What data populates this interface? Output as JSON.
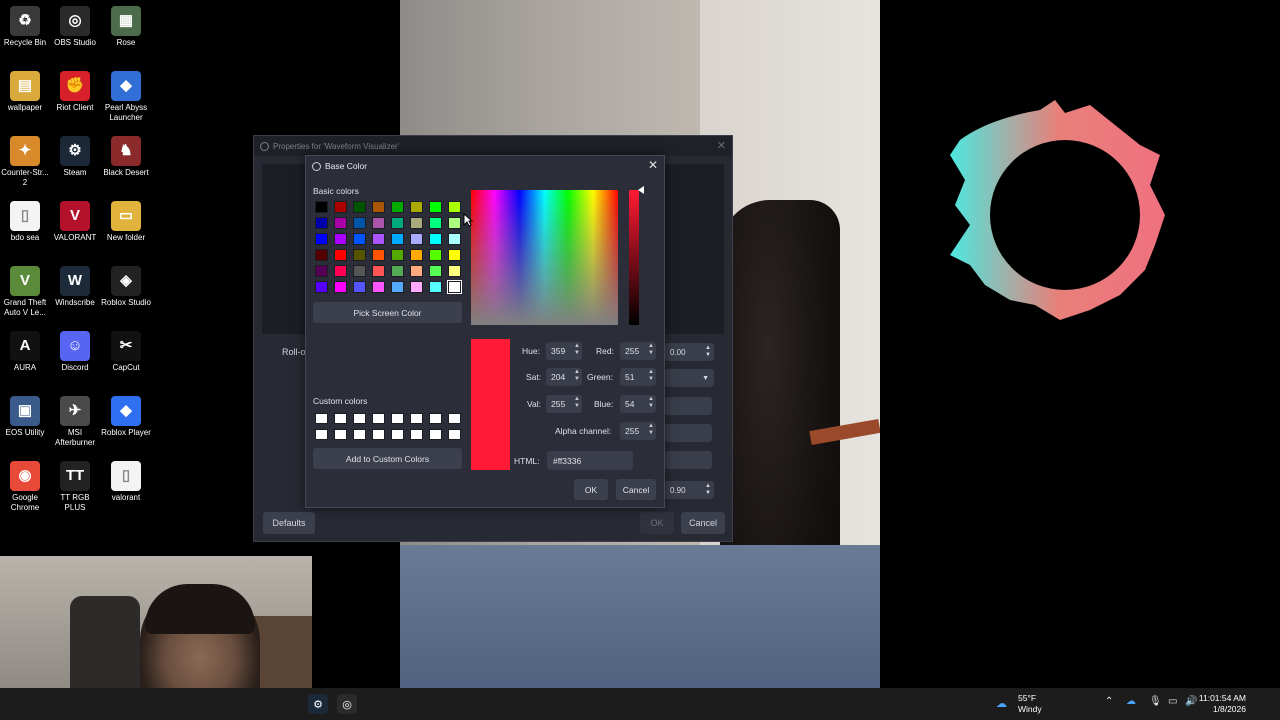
{
  "desktop": {
    "icons": [
      {
        "label": "Recycle Bin",
        "color": "#3a3a3a",
        "glyph": "♻"
      },
      {
        "label": "OBS Studio",
        "color": "#2a2a2a",
        "glyph": "◎"
      },
      {
        "label": "Rose",
        "color": "#4b6b4a",
        "glyph": "▦"
      },
      {
        "label": "wallpaper",
        "color": "#d9a93b",
        "glyph": "▤"
      },
      {
        "label": "Riot Client",
        "color": "#d8202a",
        "glyph": "✊"
      },
      {
        "label": "Pearl Abyss Launcher",
        "color": "#2f6fd6",
        "glyph": "◆"
      },
      {
        "label": "Counter-Str... 2",
        "color": "#d88a2a",
        "glyph": "✦"
      },
      {
        "label": "Steam",
        "color": "#1b2838",
        "glyph": "⚙"
      },
      {
        "label": "Black Desert",
        "color": "#8a2a2a",
        "glyph": "♞"
      },
      {
        "label": "bdo sea",
        "color": "#f4f4f4",
        "glyph": "▯"
      },
      {
        "label": "VALORANT",
        "color": "#b3122a",
        "glyph": "V"
      },
      {
        "label": "New folder",
        "color": "#e2b33c",
        "glyph": "▭"
      },
      {
        "label": "Grand Theft Auto V Le...",
        "color": "#5a8a3a",
        "glyph": "V"
      },
      {
        "label": "Windscribe",
        "color": "#1c2a3a",
        "glyph": "W"
      },
      {
        "label": "Roblox Studio",
        "color": "#222222",
        "glyph": "◈"
      },
      {
        "label": "AURA",
        "color": "#111111",
        "glyph": "A"
      },
      {
        "label": "Discord",
        "color": "#5865f2",
        "glyph": "☺"
      },
      {
        "label": "CapCut",
        "color": "#111111",
        "glyph": "✂"
      },
      {
        "label": "EOS Utility",
        "color": "#3a5a8a",
        "glyph": "▣"
      },
      {
        "label": "MSI Afterburner",
        "color": "#4a4a4a",
        "glyph": "✈"
      },
      {
        "label": "Roblox Player",
        "color": "#2f6ff2",
        "glyph": "◆"
      },
      {
        "label": "Google Chrome",
        "color": "#e84a3a",
        "glyph": "◉"
      },
      {
        "label": "TT RGB PLUS",
        "color": "#222222",
        "glyph": "TT"
      },
      {
        "label": "valorant",
        "color": "#f4f4f4",
        "glyph": "▯"
      }
    ]
  },
  "properties_window": {
    "title": "Properties for 'Waveform Visualizer'",
    "rollo_label": "Roll-o",
    "value_top": "0.00",
    "value_bottom": "0.90",
    "defaults_label": "Defaults",
    "ok_label": "OK",
    "cancel_label": "Cancel"
  },
  "color_dialog": {
    "title": "Base Color",
    "basic_colors_label": "Basic colors",
    "pick_screen_label": "Pick Screen Color",
    "custom_colors_label": "Custom colors",
    "add_custom_label": "Add to Custom Colors",
    "hue_label": "Hue:",
    "hue_value": "359",
    "sat_label": "Sat:",
    "sat_value": "204",
    "val_label": "Val:",
    "val_value": "255",
    "red_label": "Red:",
    "red_value": "255",
    "green_label": "Green:",
    "green_value": "51",
    "blue_label": "Blue:",
    "blue_value": "54",
    "alpha_label": "Alpha channel:",
    "alpha_value": "255",
    "html_label": "HTML:",
    "html_value": "#ff3336",
    "ok_label": "OK",
    "cancel_label": "Cancel",
    "current_color": "#ff1a36",
    "basic_colors": [
      "#000000",
      "#aa0000",
      "#005500",
      "#aa5500",
      "#00aa00",
      "#aaaa00",
      "#00ff00",
      "#aaff00",
      "#0000aa",
      "#aa00aa",
      "#0055aa",
      "#aa55aa",
      "#00aa7f",
      "#aaaa7f",
      "#00ff7f",
      "#aaff7f",
      "#0000ff",
      "#aa00ff",
      "#0055ff",
      "#aa55ff",
      "#00aaff",
      "#aaaaff",
      "#00ffff",
      "#aaffff",
      "#550000",
      "#ff0000",
      "#555500",
      "#ff5500",
      "#55aa00",
      "#ffaa00",
      "#55ff00",
      "#ffff00",
      "#550055",
      "#ff0055",
      "#555555",
      "#ff5555",
      "#55aa55",
      "#ffaa7f",
      "#55ff55",
      "#ffff7f",
      "#5500ff",
      "#ff00ff",
      "#5555ff",
      "#ff55ff",
      "#55aaff",
      "#ffaaff",
      "#55ffff",
      "#ffffff"
    ]
  },
  "taskbar": {
    "weather_temp": "55°F",
    "weather_desc": "Windy",
    "time": "11:01:54 AM",
    "date": "1/8/2026"
  }
}
